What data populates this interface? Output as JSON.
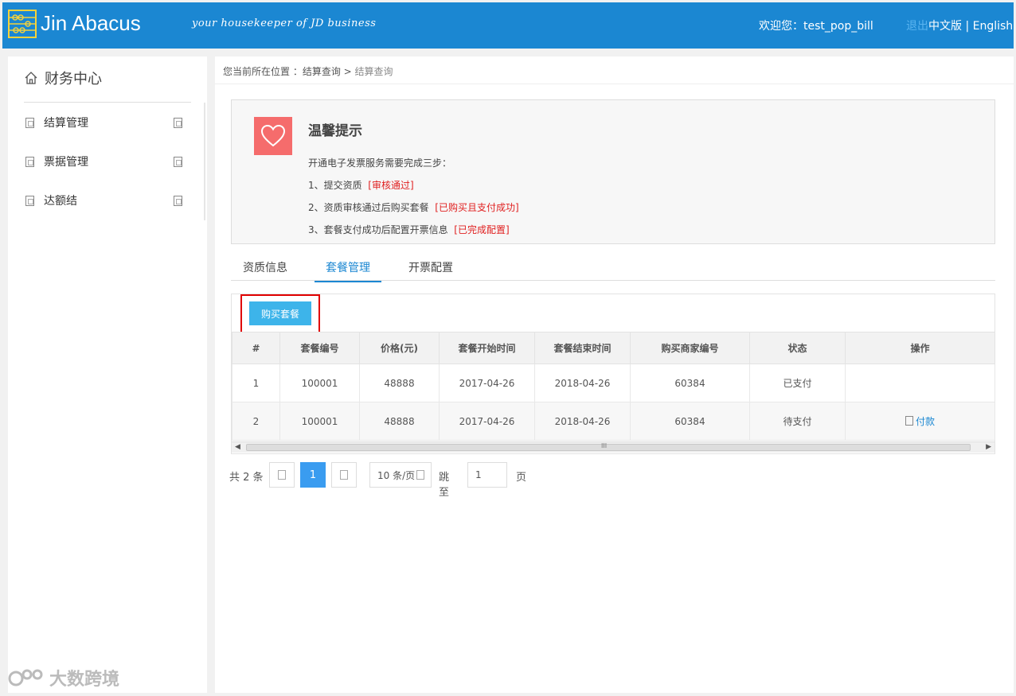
{
  "header": {
    "logo_icon": "abacus-icon",
    "app_name": "Jin Abacus",
    "slogan": "your housekeeper of JD business",
    "welcome": "欢迎您：test_pop_bill",
    "logout": "退出",
    "lang_cn": "中文版",
    "lang_sep": "|",
    "lang_en": "English",
    "bg_color": "#1b87d2"
  },
  "sidebar": {
    "title_icon": "home-icon",
    "title": "财务中心",
    "items": [
      {
        "label": "结算管理",
        "icon": "menu-icon"
      },
      {
        "label": "票据管理",
        "icon": "menu-icon"
      },
      {
        "label": "达额结",
        "icon": "menu-icon"
      }
    ]
  },
  "breadcrumb": {
    "prefix": "您当前所在位置 ：结算查询",
    "sep": ">",
    "current": "结算查询"
  },
  "notice": {
    "icon": "heart-icon",
    "title": "温馨提示",
    "intro": "开通电子发票服务需要完成三步：",
    "steps": [
      {
        "text": "1、提交资质",
        "status": "[审核通过]"
      },
      {
        "text": "2、资质审核通过后购买套餐",
        "status": "[已购买且支付成功]"
      },
      {
        "text": "3、套餐支付成功后配置开票信息",
        "status": "[已完成配置]"
      }
    ],
    "icon_color": "#f56c6c",
    "status_color": "#e02020"
  },
  "tabs": [
    {
      "label": "资质信息",
      "active": false
    },
    {
      "label": "套餐管理",
      "active": true
    },
    {
      "label": "开票配置",
      "active": false
    }
  ],
  "toolbar": {
    "buy_label": "购买套餐",
    "buy_color": "#3db4ea"
  },
  "table": {
    "columns": [
      "#",
      "套餐编号",
      "价格(元)",
      "套餐开始时间",
      "套餐结束时间",
      "购买商家编号",
      "状态",
      "操作"
    ],
    "rows": [
      {
        "no": "1",
        "pkg": "100001",
        "price": "48888",
        "start": "2017-04-26",
        "end": "2018-04-26",
        "merchant": "60384",
        "status": "已支付",
        "action": ""
      },
      {
        "no": "2",
        "pkg": "100001",
        "price": "48888",
        "start": "2017-04-26",
        "end": "2018-04-26",
        "merchant": "60384",
        "status": "待支付",
        "action": "付款"
      }
    ],
    "scroll_mid": "III"
  },
  "pager": {
    "total": "共 2 条",
    "current_page": "1",
    "page_size": "10 条/页",
    "jump_label": "跳至",
    "jump_value": "1",
    "page_suffix": "页"
  },
  "watermark": {
    "text": "大数跨境",
    "icon": "brand-logo-icon"
  }
}
